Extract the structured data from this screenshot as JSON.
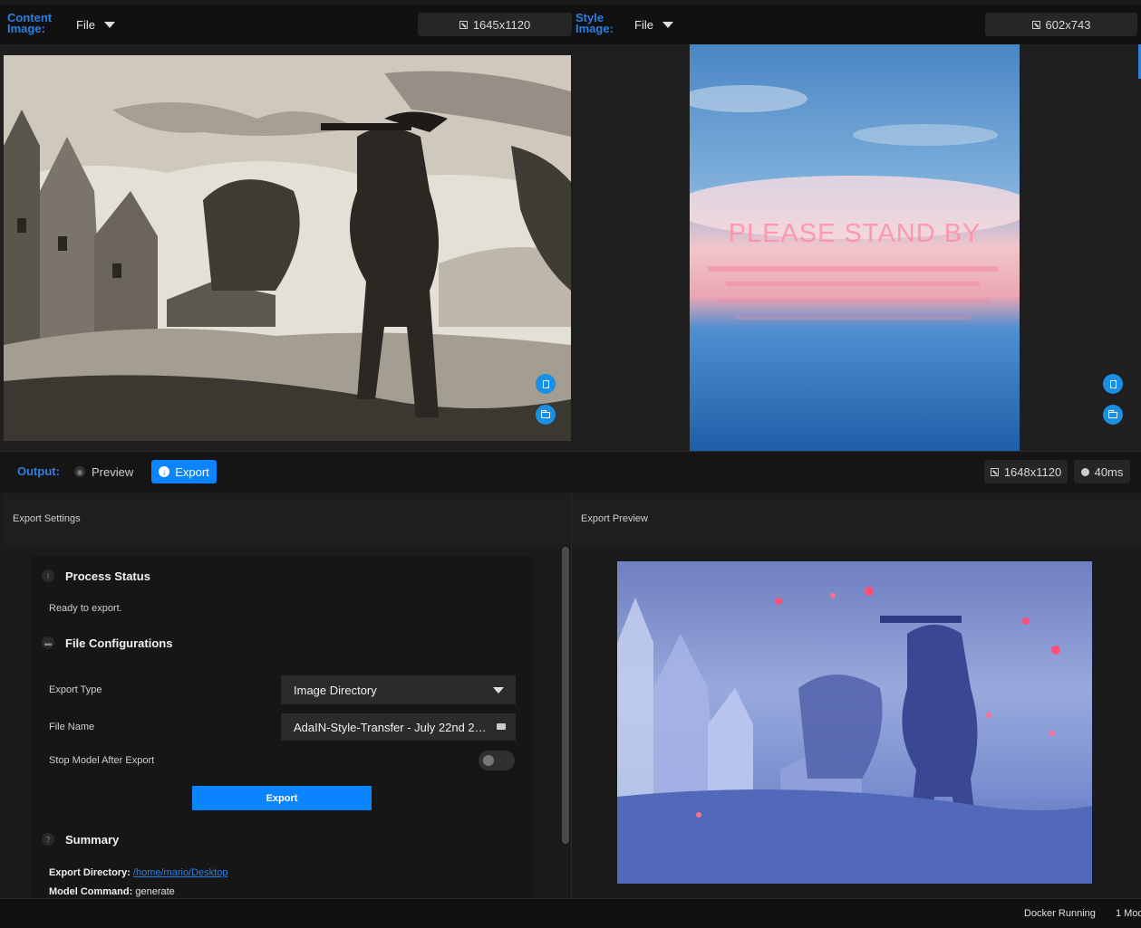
{
  "content_image": {
    "label": "Content Image:",
    "source": "File",
    "dimensions": "1645x1120"
  },
  "style_image": {
    "label": "Style Image:",
    "source": "File",
    "dimensions": "602x743",
    "artwork_text": "PLEASE STAND BY"
  },
  "output_bar": {
    "label": "Output:",
    "preview_label": "Preview",
    "export_label": "Export",
    "dimensions": "1648x1120",
    "time": "40ms"
  },
  "export_settings": {
    "header": "Export Settings",
    "process_status": {
      "title": "Process Status",
      "icon": "i",
      "message": "Ready to export."
    },
    "file_config": {
      "title": "File Configurations",
      "export_type_label": "Export Type",
      "export_type_value": "Image Directory",
      "file_name_label": "File Name",
      "file_name_value": "AdaIN-Style-Transfer - July 22nd 2…",
      "stop_model_label": "Stop Model After Export",
      "stop_model_value": false
    },
    "export_button": "Export",
    "summary": {
      "title": "Summary",
      "icon": "?",
      "export_directory_label": "Export Directory:",
      "export_directory_value": "/home/mario/Desktop",
      "model_command_label": "Model Command:",
      "model_command_value": "generate"
    }
  },
  "export_preview": {
    "header": "Export Preview"
  },
  "status_bar": {
    "docker_status": "Docker Running",
    "models": "1 Mod"
  },
  "colors": {
    "accent": "#0a84ff",
    "label_blue": "#2f7fe0",
    "background": "#1b1b1c"
  }
}
